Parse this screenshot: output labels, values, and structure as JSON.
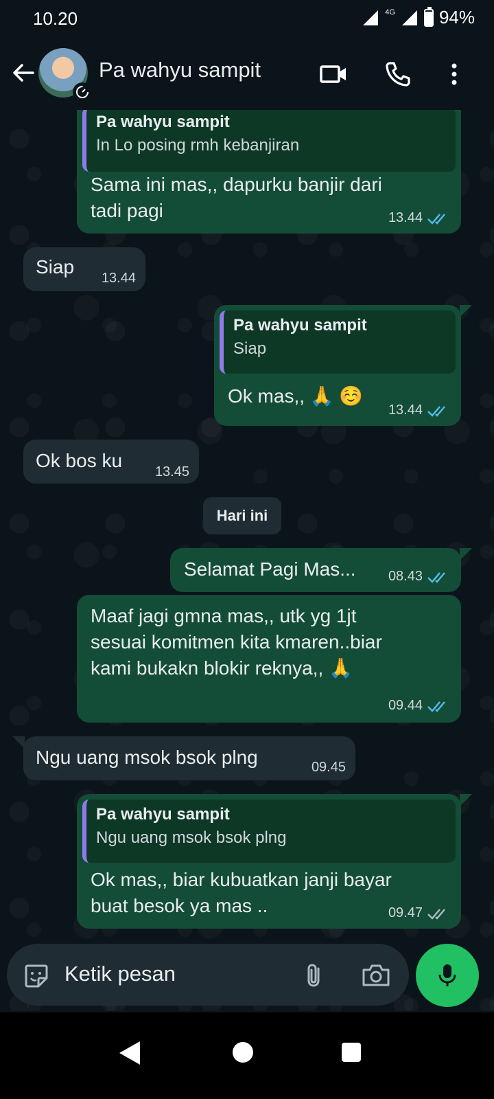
{
  "status_bar": {
    "time": "10.20",
    "network": "4G",
    "battery": "94%"
  },
  "header": {
    "contact_name": "Pa wahyu sampit"
  },
  "messages": [
    {
      "dir": "out",
      "quote_name": "Pa wahyu sampit",
      "quote_text": "In Lo posing rmh kebanjiran",
      "line1": "Sama ini mas,, dapurku banjir dari",
      "line2": "tadi pagi",
      "time": "13.44",
      "status": "read"
    },
    {
      "dir": "in",
      "text": "Siap",
      "time": "13.44"
    },
    {
      "dir": "out",
      "quote_name": "Pa wahyu sampit",
      "quote_text": "Siap",
      "text": "Ok mas,, 🙏 ☺️",
      "time": "13.44",
      "status": "read"
    },
    {
      "dir": "in",
      "text": "Ok bos ku",
      "time": "13.45"
    },
    {
      "dir": "out",
      "text": "Selamat Pagi Mas...",
      "time": "08.43",
      "status": "read"
    },
    {
      "dir": "out",
      "line1": "Maaf jagi gmna mas,, utk yg 1jt",
      "line2": "sesuai komitmen kita kmaren..biar",
      "line3": "kami bukakn blokir reknya,, 🙏",
      "time": "09.44",
      "status": "read"
    },
    {
      "dir": "in",
      "text": "Ngu uang msok bsok plng",
      "time": "09.45"
    },
    {
      "dir": "out",
      "quote_name": "Pa wahyu sampit",
      "quote_text": "Ngu uang msok bsok plng",
      "line1": "Ok mas,, biar kubuatkan janji bayar",
      "line2": "buat besok ya mas ..",
      "time": "09.47",
      "status": "delivered"
    }
  ],
  "date_separator": "Hari ini",
  "input": {
    "placeholder": "Ketik pesan"
  },
  "colors": {
    "accent": "#21c063",
    "outgoing_bubble": "#144d37",
    "incoming_bubble": "#202c33",
    "read_tick": "#53bdeb",
    "quote_bar": "#8f7be8"
  },
  "icons": [
    "back-arrow-icon",
    "video-call-icon",
    "voice-call-icon",
    "more-options-icon",
    "sticker-icon",
    "attach-icon",
    "camera-icon",
    "mic-icon"
  ]
}
